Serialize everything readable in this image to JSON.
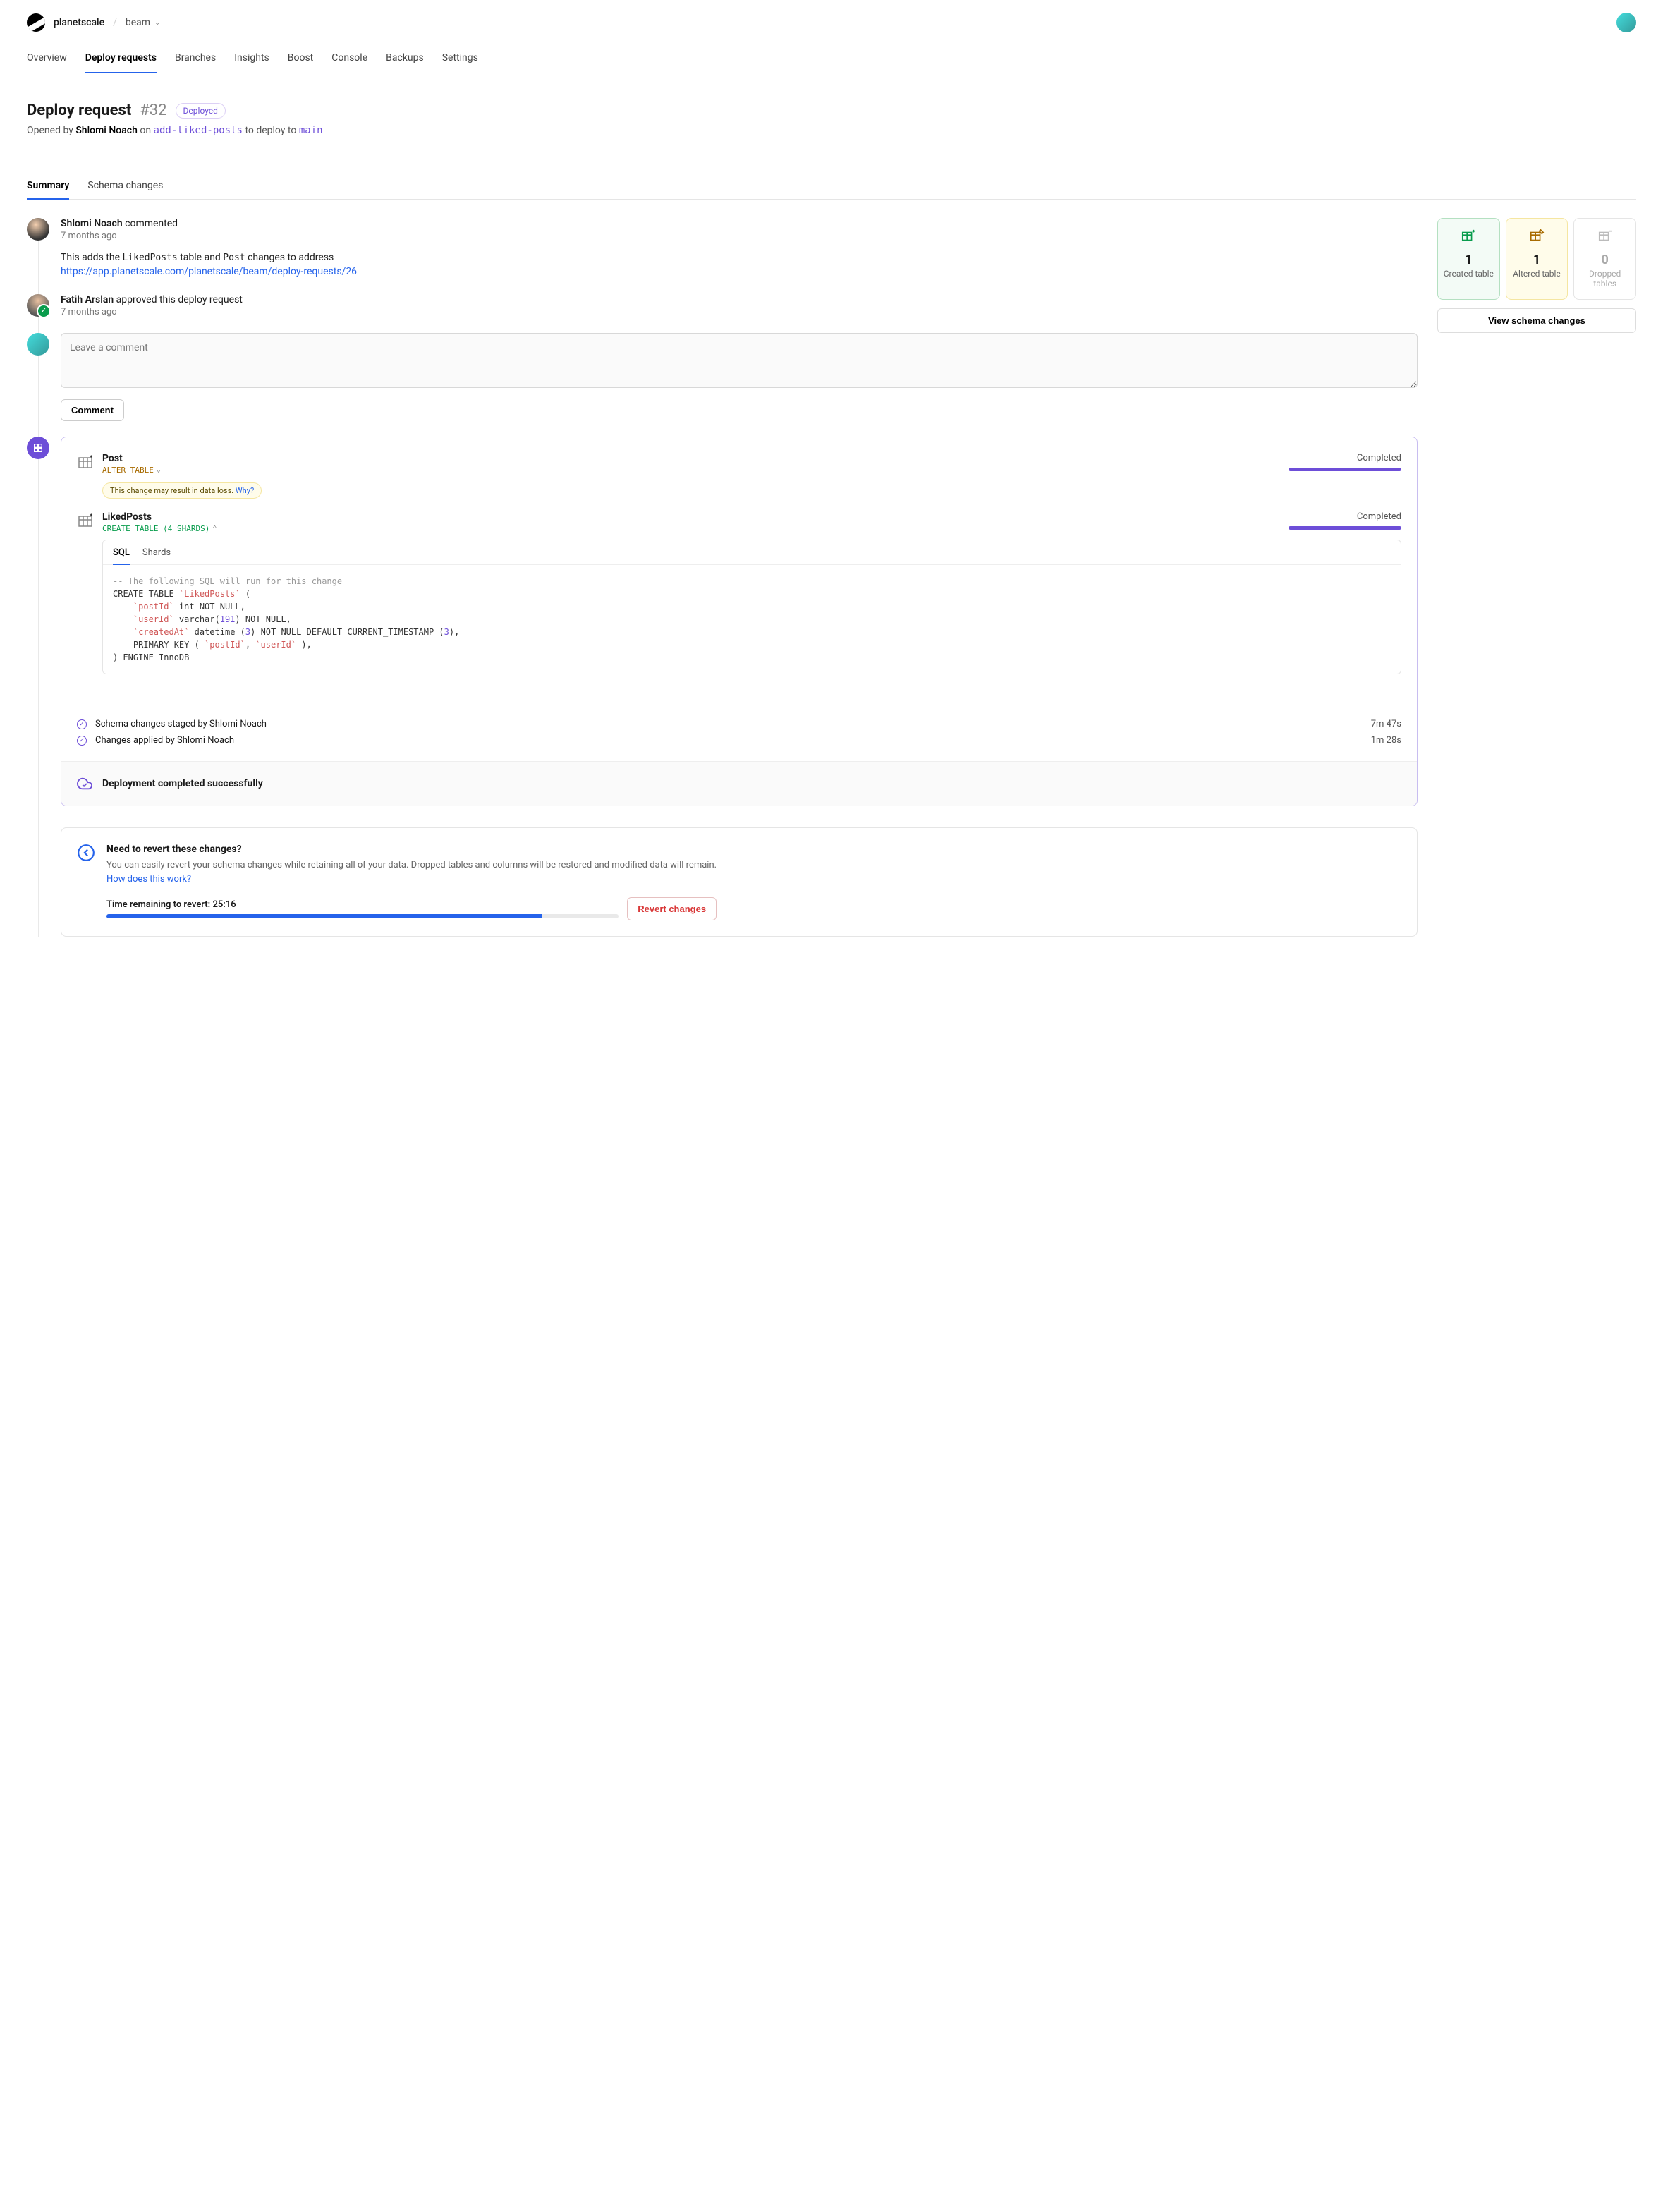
{
  "breadcrumb": {
    "org": "planetscale",
    "db": "beam"
  },
  "nav": [
    "Overview",
    "Deploy requests",
    "Branches",
    "Insights",
    "Boost",
    "Console",
    "Backups",
    "Settings"
  ],
  "nav_active": 1,
  "page": {
    "title": "Deploy request",
    "number": "#32",
    "status": "Deployed",
    "opened_by": "Opened by ",
    "opener": "Shlomi Noach",
    "on_text": " on ",
    "branch": "add-liked-posts",
    "deploy_text": " to deploy to ",
    "target": "main"
  },
  "tabs": [
    "Summary",
    "Schema changes"
  ],
  "tabs_active": 0,
  "timeline": {
    "comment": {
      "user": "Shlomi Noach",
      "action": " commented",
      "time": "7 months ago",
      "text_pre": "This adds the ",
      "code1": "LikedPosts",
      "text_mid": " table and ",
      "code2": "Post",
      "text_post": " changes to address",
      "link": "https://app.planetscale.com/planetscale/beam/deploy-requests/26"
    },
    "approve": {
      "user": "Fatih Arslan",
      "action": " approved this deploy request",
      "time": "7 months ago"
    },
    "comment_placeholder": "Leave a comment",
    "comment_btn": "Comment"
  },
  "changes": [
    {
      "name": "Post",
      "op": "ALTER TABLE",
      "op_class": "op-alter",
      "status": "Completed",
      "warn": "This change may result in data loss. ",
      "warn_link": "Why?"
    },
    {
      "name": "LikedPosts",
      "op": "CREATE TABLE (4 shards)",
      "op_class": "op-create",
      "status": "Completed"
    }
  ],
  "sql_tabs": [
    "SQL",
    "Shards"
  ],
  "sql": {
    "l1": "-- The following SQL will run for this change",
    "l2a": "CREATE TABLE ",
    "l2b": "`LikedPosts`",
    "l2c": " (",
    "l3a": "    ",
    "l3b": "`postId`",
    "l3c": " int ",
    "l3d": "NOT NULL",
    "l3e": ",",
    "l4a": "    ",
    "l4b": "`userId`",
    "l4c": " varchar(",
    "l4d": "191",
    "l4e": ") ",
    "l4f": "NOT NULL",
    "l4g": ",",
    "l5a": "    ",
    "l5b": "`createdAt`",
    "l5c": " datetime (",
    "l5d": "3",
    "l5e": ") ",
    "l5f": "NOT NULL DEFAULT CURRENT_TIMESTAMP",
    "l5g": " (",
    "l5h": "3",
    "l5i": "),",
    "l6a": "    PRIMARY KEY ( ",
    "l6b": "`postId`",
    "l6c": ", ",
    "l6d": "`userId`",
    "l6e": " ),",
    "l7": ") ENGINE InnoDB"
  },
  "events": [
    {
      "text": "Schema changes staged by Shlomi Noach",
      "dur": "7m 47s"
    },
    {
      "text": "Changes applied by Shlomi Noach",
      "dur": "1m 28s"
    }
  ],
  "deploy_done": "Deployment completed successfully",
  "revert": {
    "title": "Need to revert these changes?",
    "desc": "You can easily revert your schema changes while retaining all of your data. Dropped tables and columns will be restored and modified data will remain.",
    "link": "How does this work?",
    "time_label": "Time remaining to revert: ",
    "time": "25:16",
    "btn": "Revert changes"
  },
  "stats": {
    "created": {
      "n": "1",
      "lbl": "Created table"
    },
    "altered": {
      "n": "1",
      "lbl": "Altered table"
    },
    "dropped": {
      "n": "0",
      "lbl": "Dropped tables"
    },
    "view_btn": "View schema changes"
  }
}
